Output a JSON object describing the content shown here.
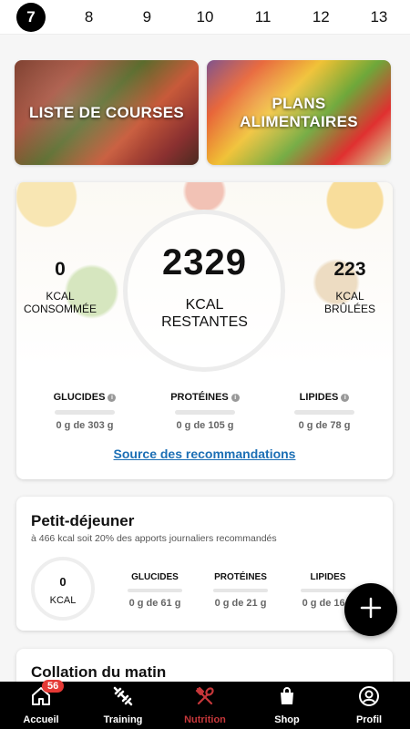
{
  "dates": [
    "7",
    "8",
    "9",
    "10",
    "11",
    "12",
    "13"
  ],
  "selected_date": "7",
  "tiles": {
    "shopping_list": "LISTE DE COURSES",
    "meal_plans_line1": "PLANS",
    "meal_plans_line2": "ALIMENTAIRES"
  },
  "summary": {
    "consumed_value": "0",
    "consumed_label_1": "KCAL",
    "consumed_label_2": "CONSOMMÉE",
    "remaining_value": "2329",
    "remaining_label_1": "KCAL",
    "remaining_label_2": "RESTANTES",
    "burned_value": "223",
    "burned_label_1": "KCAL",
    "burned_label_2": "BRÛLÉES",
    "macros": [
      {
        "name": "GLUCIDES",
        "value": "0 g de 303 g"
      },
      {
        "name": "PROTÉINES",
        "value": "0 g de 105 g"
      },
      {
        "name": "LIPIDES",
        "value": "0 g de 78 g"
      }
    ],
    "source_link": "Source des recommandations"
  },
  "breakfast": {
    "title": "Petit-déjeuner",
    "subtitle": "à 466 kcal soit 20% des apports journaliers recommandés",
    "kcal_value": "0",
    "kcal_unit": "KCAL",
    "macros": [
      {
        "name": "GLUCIDES",
        "value": "0 g de 61 g"
      },
      {
        "name": "PROTÉINES",
        "value": "0 g de 21 g"
      },
      {
        "name": "LIPIDES",
        "value": "0 g de 16 g"
      }
    ]
  },
  "next_meal": {
    "title": "Collation du matin"
  },
  "nav": {
    "items": [
      {
        "label": "Accueil",
        "icon": "home-icon"
      },
      {
        "label": "Training",
        "icon": "dumbbell-icon"
      },
      {
        "label": "Nutrition",
        "icon": "fork-spoon-icon"
      },
      {
        "label": "Shop",
        "icon": "shopping-bag-icon"
      },
      {
        "label": "Profil",
        "icon": "user-icon"
      }
    ],
    "home_badge": "56",
    "active": "Nutrition",
    "active_color": "#c6373a"
  },
  "colors": {
    "link": "#1c6fb5",
    "badge": "#e53935"
  }
}
